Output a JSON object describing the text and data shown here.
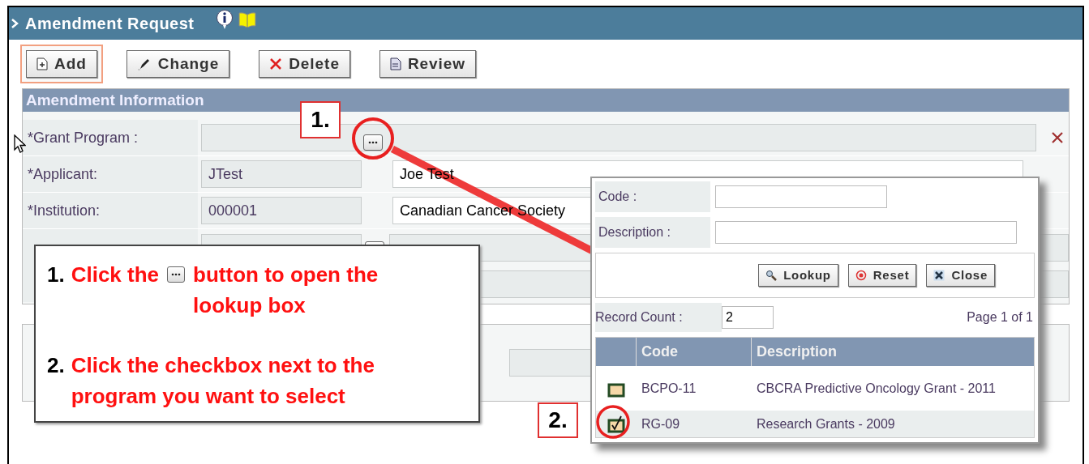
{
  "page": {
    "title": "Amendment Request"
  },
  "toolbar": [
    {
      "label": "Add",
      "highlighted": true
    },
    {
      "label": "Change",
      "highlighted": false
    },
    {
      "label": "Delete",
      "highlighted": false
    },
    {
      "label": "Review",
      "highlighted": false
    }
  ],
  "amendment_information": {
    "title": "Amendment Information",
    "rows": [
      {
        "kind": "lookup",
        "label": "*Grant Program :"
      },
      {
        "kind": "pair",
        "label": "*Applicant:",
        "code": "JTest",
        "name": "Joe Test"
      },
      {
        "kind": "pair",
        "label": "*Institution:",
        "code": "000001",
        "name": "Canadian Cancer Society"
      }
    ]
  },
  "lookup_box": {
    "fields": [
      {
        "label": "Code :"
      },
      {
        "label": "Description :"
      }
    ],
    "buttons": [
      {
        "label": "Lookup"
      },
      {
        "label": "Reset"
      },
      {
        "label": "Close"
      }
    ],
    "record_count_label": "Record Count :",
    "record_count": "2",
    "page": "Page 1 of 1",
    "columns": [
      "Code",
      "Description"
    ],
    "rows": [
      {
        "code": "BCPO-11",
        "description": "CBCRA Predictive Oncology Grant - 2011",
        "checked": false
      },
      {
        "code": "RG-09",
        "description": "Research Grants - 2009",
        "checked": true
      }
    ]
  },
  "step_markers": [
    "1.",
    "2."
  ],
  "instructions": [
    {
      "number": "1.",
      "before": "Click the",
      "after": "button to open the lookup box"
    },
    {
      "number": "2.",
      "before": "Click the checkbox next to the program you want to select"
    }
  ]
}
